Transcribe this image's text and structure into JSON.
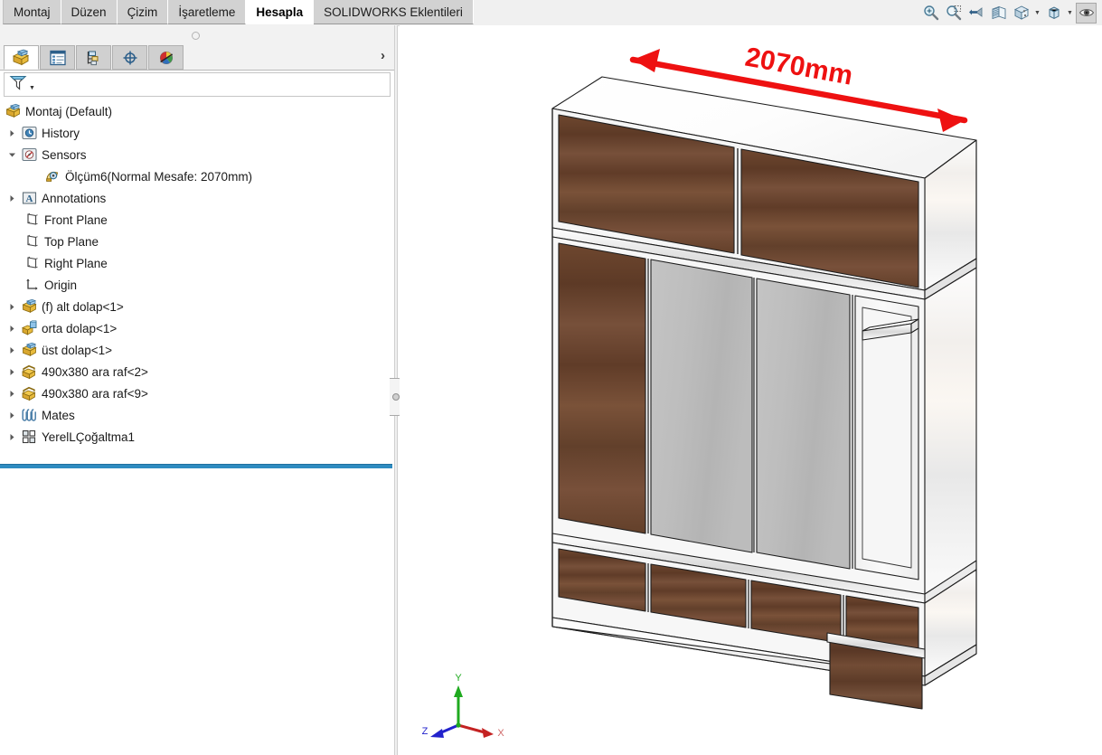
{
  "window": {
    "app": "SOLIDWORKS",
    "document_title": "Montaj",
    "configuration": "Default"
  },
  "ribbon": {
    "tabs": [
      {
        "label": "Montaj",
        "active": false,
        "icon": "assembly-tab-icon"
      },
      {
        "label": "Düzen",
        "active": false,
        "icon": "layout-tab-icon"
      },
      {
        "label": "Çizim",
        "active": false,
        "icon": "sketch-tab-icon"
      },
      {
        "label": "İşaretleme",
        "active": false,
        "icon": "markup-tab-icon"
      },
      {
        "label": "Hesapla",
        "active": true,
        "icon": "evaluate-tab-icon"
      },
      {
        "label": "SOLIDWORKS Eklentileri",
        "active": false,
        "icon": "addins-tab-icon"
      }
    ]
  },
  "view_toolbar": {
    "buttons": [
      {
        "name": "zoom-to-fit-icon",
        "tooltip": "Zoom to Fit",
        "pressed": false,
        "caret": false
      },
      {
        "name": "zoom-to-area-icon",
        "tooltip": "Zoom to Area",
        "pressed": false,
        "caret": false
      },
      {
        "name": "previous-view-icon",
        "tooltip": "Previous View",
        "pressed": false,
        "caret": false
      },
      {
        "name": "section-view-icon",
        "tooltip": "Section View",
        "pressed": false,
        "caret": false
      },
      {
        "name": "view-orientation-icon",
        "tooltip": "View Orientation",
        "pressed": false,
        "caret": true
      },
      {
        "name": "display-style-icon",
        "tooltip": "Display Style",
        "pressed": false,
        "caret": true
      },
      {
        "name": "hide-show-items-icon",
        "tooltip": "Hide/Show Items",
        "pressed": true,
        "caret": false
      }
    ]
  },
  "panel": {
    "tabs": [
      {
        "name": "feature-manager-tab",
        "icon": "yellow-cube-icon",
        "label": "FeatureManager",
        "active": true
      },
      {
        "name": "property-manager-tab",
        "icon": "property-list-icon",
        "label": "PropertyManager",
        "active": false
      },
      {
        "name": "configuration-manager-tab",
        "icon": "configuration-icon",
        "label": "ConfigurationManager",
        "active": false
      },
      {
        "name": "dimxpert-manager-tab",
        "icon": "crosshair-icon",
        "label": "DimXpertManager",
        "active": false
      },
      {
        "name": "display-manager-tab",
        "icon": "color-wheel-icon",
        "label": "DisplayManager",
        "active": false
      }
    ],
    "expand_arrow": "›",
    "filter": {
      "icon": "filter-funnel-icon",
      "placeholder": "",
      "value": ""
    }
  },
  "tree": {
    "root": {
      "label": "Montaj  (Default)",
      "icon": "assembly-icon"
    },
    "items": [
      {
        "label": "History",
        "icon": "history-folder-icon",
        "indent": 0,
        "arrow": "collapsed",
        "selected": false
      },
      {
        "label": "Sensors",
        "icon": "sensors-folder-icon",
        "indent": 0,
        "arrow": "expanded",
        "selected": false
      },
      {
        "label": "Ölçüm6(Normal Mesafe: 2070mm)",
        "icon": "measure-sensor-icon",
        "indent": 1,
        "arrow": "none",
        "selected": false
      },
      {
        "label": "Annotations",
        "icon": "annotations-folder-icon",
        "indent": 0,
        "arrow": "collapsed",
        "selected": false
      },
      {
        "label": "Front Plane",
        "icon": "plane-icon",
        "indent": 0,
        "arrow": "none",
        "selected": false
      },
      {
        "label": "Top Plane",
        "icon": "plane-icon",
        "indent": 0,
        "arrow": "none",
        "selected": false
      },
      {
        "label": "Right Plane",
        "icon": "plane-icon",
        "indent": 0,
        "arrow": "none",
        "selected": false
      },
      {
        "label": "Origin",
        "icon": "origin-icon",
        "indent": 0,
        "arrow": "none",
        "selected": false
      },
      {
        "label": "(f) alt dolap<1>",
        "icon": "part-icon",
        "indent": 0,
        "arrow": "collapsed",
        "selected": false
      },
      {
        "label": "orta dolap<1>",
        "icon": "subassembly-icon",
        "indent": 0,
        "arrow": "collapsed",
        "selected": false
      },
      {
        "label": "üst dolap<1>",
        "icon": "part-icon",
        "indent": 0,
        "arrow": "collapsed",
        "selected": false
      },
      {
        "label": "490x380 ara raf<2>",
        "icon": "sheetmetal-part-icon",
        "indent": 0,
        "arrow": "collapsed",
        "selected": false
      },
      {
        "label": "490x380 ara raf<9>",
        "icon": "sheetmetal-part-icon",
        "indent": 0,
        "arrow": "collapsed",
        "selected": false
      },
      {
        "label": "Mates",
        "icon": "mates-folder-icon",
        "indent": 0,
        "arrow": "collapsed",
        "selected": false
      },
      {
        "label": "YerelLÇoğaltma1",
        "icon": "local-pattern-icon",
        "indent": 0,
        "arrow": "collapsed",
        "selected": false
      }
    ],
    "rollback_bar": true
  },
  "model": {
    "name": "wardrobe-cabinet-assembly",
    "dimension_annotation": {
      "text": "2070mm",
      "color": "#ee1111",
      "arrow_style": "double-headed"
    },
    "colors": {
      "wood_dark": "#6b4430",
      "wood_mid": "#7a5038",
      "wood_light": "#8a5c42",
      "carcass_white": "#fbfbfb",
      "carcass_shade": "#e9e9e9",
      "mirror_grey": "#b9b9b9",
      "mirror_grey_light": "#c6c6c6",
      "edge_line": "#222222",
      "edge_band": "#d8d8d8"
    },
    "sections": [
      {
        "name": "top-cabinet",
        "doors": 2,
        "finish": "wood_dark"
      },
      {
        "name": "middle-cabinet",
        "doors": 4,
        "finish": "mixed-wood-mirror"
      },
      {
        "name": "bottom-cabinet",
        "doors": 4,
        "finish": "wood_dark"
      },
      {
        "name": "open-compartment-right",
        "shelves": 1,
        "finish": "carcass_white"
      }
    ]
  },
  "triad": {
    "labels": {
      "x": "X",
      "y": "Y",
      "z": "Z"
    },
    "colors": {
      "x": "#cc2222",
      "y": "#22aa22",
      "z": "#2222cc"
    }
  }
}
